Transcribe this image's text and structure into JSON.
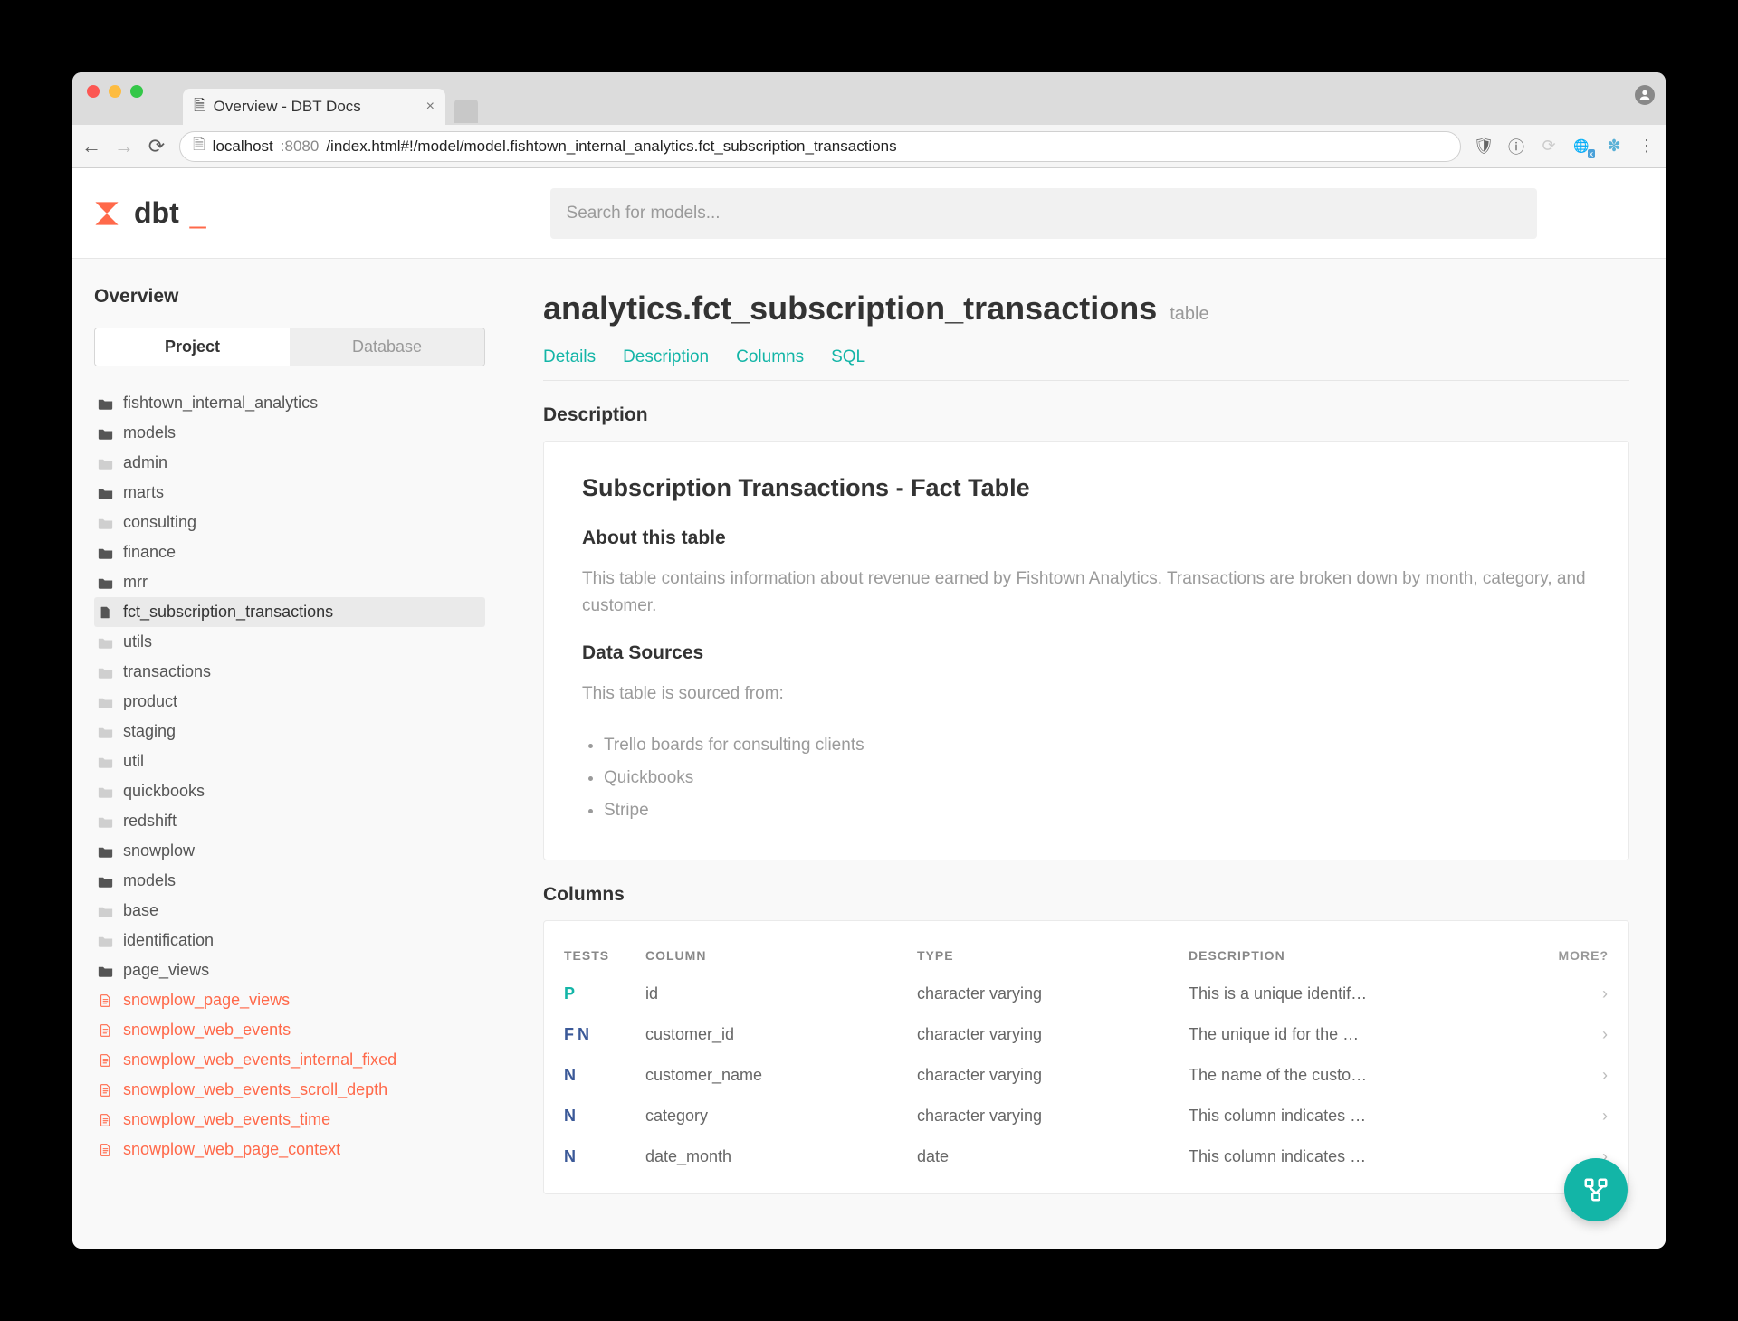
{
  "browser": {
    "tab_title": "Overview - DBT Docs",
    "url_host": "localhost",
    "url_port": ":8080",
    "url_path": "/index.html#!/model/model.fishtown_internal_analytics.fct_subscription_transactions"
  },
  "search": {
    "placeholder": "Search for models..."
  },
  "logo": "dbt",
  "sidebar": {
    "title": "Overview",
    "tabs": {
      "active": "Project",
      "inactive": "Database"
    },
    "items": [
      {
        "label": "fishtown_internal_analytics",
        "icon": "folder-open",
        "ind": 0
      },
      {
        "label": "models",
        "icon": "folder-open",
        "ind": 1
      },
      {
        "label": "admin",
        "icon": "folder-closed",
        "ind": 2
      },
      {
        "label": "marts",
        "icon": "folder-open",
        "ind": 2
      },
      {
        "label": "consulting",
        "icon": "folder-closed",
        "ind": 3
      },
      {
        "label": "finance",
        "icon": "folder-open",
        "ind": 3
      },
      {
        "label": "mrr",
        "icon": "folder-open",
        "ind": 4
      },
      {
        "label": "fct_subscription_transactions",
        "icon": "file",
        "ind": 5,
        "sel": true
      },
      {
        "label": "utils",
        "icon": "folder-closed",
        "ind": 5
      },
      {
        "label": "transactions",
        "icon": "folder-closed",
        "ind": 4
      },
      {
        "label": "product",
        "icon": "folder-closed",
        "ind": 3
      },
      {
        "label": "staging",
        "icon": "folder-closed",
        "ind": 2
      },
      {
        "label": "util",
        "icon": "folder-closed",
        "ind": 2
      },
      {
        "label": "quickbooks",
        "icon": "folder-closed",
        "ind": 1
      },
      {
        "label": "redshift",
        "icon": "folder-closed",
        "ind": 1
      },
      {
        "label": "snowplow",
        "icon": "folder-open",
        "ind": 1
      },
      {
        "label": "models",
        "icon": "folder-open",
        "ind": 2
      },
      {
        "label": "base",
        "icon": "folder-closed",
        "ind": 3
      },
      {
        "label": "identification",
        "icon": "folder-closed",
        "ind": 3
      },
      {
        "label": "page_views",
        "icon": "folder-open",
        "ind": 3
      },
      {
        "label": "snowplow_page_views",
        "icon": "file-orange",
        "ind": 4,
        "orange": true
      },
      {
        "label": "snowplow_web_events",
        "icon": "file-orange",
        "ind": 4,
        "orange": true
      },
      {
        "label": "snowplow_web_events_internal_fixed",
        "icon": "file-orange",
        "ind": 4,
        "orange": true
      },
      {
        "label": "snowplow_web_events_scroll_depth",
        "icon": "file-orange",
        "ind": 4,
        "orange": true
      },
      {
        "label": "snowplow_web_events_time",
        "icon": "file-orange",
        "ind": 4,
        "orange": true
      },
      {
        "label": "snowplow_web_page_context",
        "icon": "file-orange",
        "ind": 4,
        "orange": true
      }
    ]
  },
  "page": {
    "title": "analytics.fct_subscription_transactions",
    "kind": "table",
    "tabs": [
      "Details",
      "Description",
      "Columns",
      "SQL"
    ],
    "desc_head": "Description",
    "card": {
      "h2": "Subscription Transactions - Fact Table",
      "about_h": "About this table",
      "about_p": "This table contains information about revenue earned by Fishtown Analytics. Transactions are broken down by month, category, and customer.",
      "src_h": "Data Sources",
      "src_p": "This table is sourced from:",
      "src_list": [
        "Trello boards for consulting clients",
        "Quickbooks",
        "Stripe"
      ]
    },
    "columns_head": "Columns",
    "columns": {
      "headers": {
        "tests": "TESTS",
        "col": "COLUMN",
        "type": "TYPE",
        "desc": "DESCRIPTION",
        "more": "MORE?"
      },
      "rows": [
        {
          "tests": [
            "P"
          ],
          "col": "id",
          "type": "character varying",
          "desc": "This is a unique identif…"
        },
        {
          "tests": [
            "F",
            "N"
          ],
          "col": "customer_id",
          "type": "character varying",
          "desc": "The unique id for the …"
        },
        {
          "tests": [
            "N"
          ],
          "col": "customer_name",
          "type": "character varying",
          "desc": "The name of the custo…"
        },
        {
          "tests": [
            "N"
          ],
          "col": "category",
          "type": "character varying",
          "desc": "This column indicates …"
        },
        {
          "tests": [
            "N"
          ],
          "col": "date_month",
          "type": "date",
          "desc": "This column indicates …"
        }
      ]
    }
  }
}
